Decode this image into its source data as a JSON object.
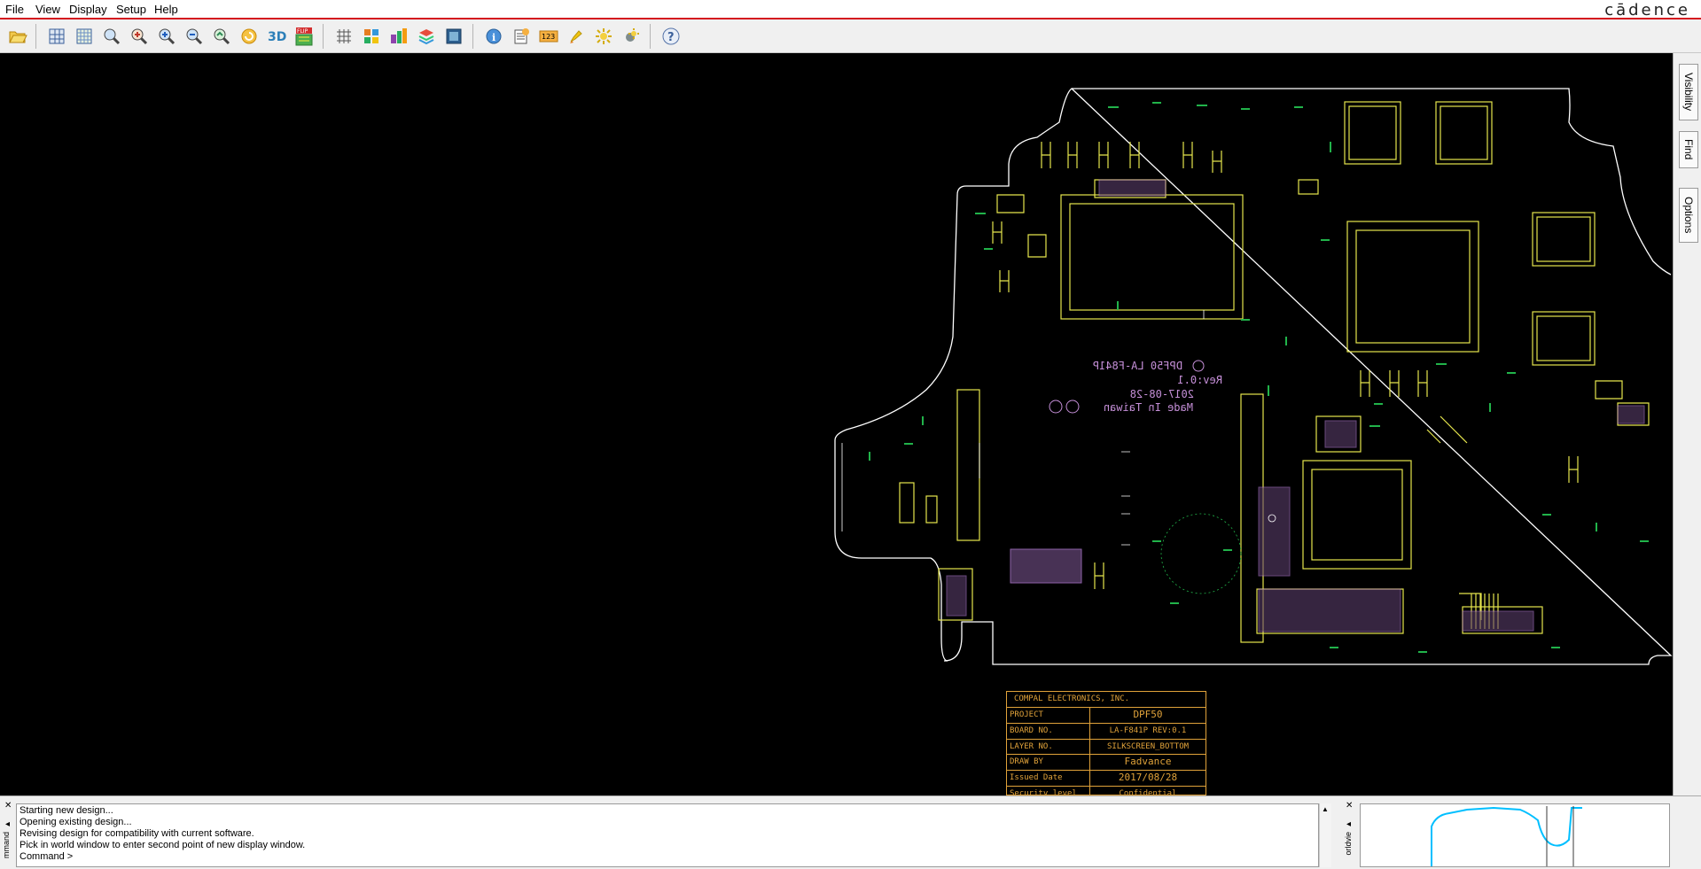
{
  "menu": {
    "file": "File",
    "view": "View",
    "display": "Display",
    "setup": "Setup",
    "help": "Help"
  },
  "brand": "cādence",
  "toolbar_icons": [
    "open-folder-icon",
    "grid-layout-icon",
    "grid-pattern-icon",
    "zoom-fit-icon",
    "zoom-in-icon",
    "zoom-in-alt-icon",
    "zoom-out-icon",
    "zoom-previous-icon",
    "refresh-icon",
    "3d-view-icon",
    "flip-icon",
    "grid-toggle-icon",
    "layers-icon",
    "color-layers-icon",
    "stack-icon",
    "board-icon",
    "info-icon",
    "report-icon",
    "number-123-icon",
    "highlight-brush-icon",
    "brightness-icon",
    "shadow-toggle-icon",
    "help-icon"
  ],
  "side_tabs": {
    "visibility": "Visibility",
    "find": "Find",
    "options": "Options"
  },
  "console_lines": [
    "Starting new design...",
    "Opening existing design...",
    "Revising design for compatibility with current software.",
    "Pick in world window to enter second point of new display window.",
    "Command >"
  ],
  "side_labels": {
    "command": "mmand",
    "worldview": "orldvie"
  },
  "board_marking": {
    "line1": "DPF50 LA-F841P",
    "line2": "Rev:0.1",
    "line3": "2017-08-28",
    "line4": "Made In Taiwan"
  },
  "title_block": {
    "company": "COMPAL ELECTRONICS, INC.",
    "rows": [
      {
        "label": "PROJECT",
        "value": "DPF50"
      },
      {
        "label": "BOARD NO.",
        "value": "LA-F841P REV:0.1"
      },
      {
        "label": "LAYER NO.",
        "value": "SILKSCREEN_BOTTOM"
      },
      {
        "label": "DRAW BY",
        "value": "Fadvance"
      },
      {
        "label": "Issued Date",
        "value": "2017/08/28"
      },
      {
        "label": "Security level",
        "value": "Confidential"
      }
    ]
  },
  "colors": {
    "canvas_bg": "#000000",
    "outline": "#ffffff",
    "silkscreen": "#e6e64d",
    "pads": "#b07ad0",
    "annot": "#21b34a",
    "menu_accent": "#d4141e",
    "title_block": "#e0a23a",
    "worldview_outline": "#00bfff"
  }
}
